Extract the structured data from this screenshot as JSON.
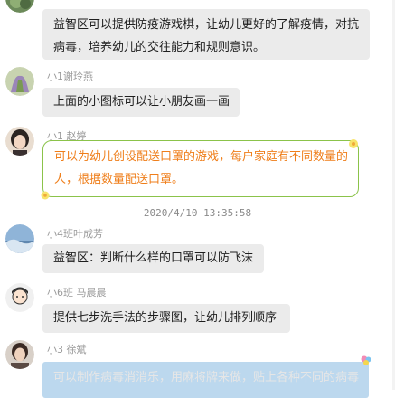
{
  "messages": [
    {
      "name": "",
      "lines": [
        "益智区可以提供防疫游戏棋，让幼儿更好的了解疫情，对抗",
        "病毒，培养幼儿的交往能力和规则意识。"
      ]
    },
    {
      "name": "小1谢玲燕",
      "lines": [
        "上面的小图标可以让小朋友画一画"
      ]
    },
    {
      "name": "小1 赵婷",
      "lines": [
        "可以为幼儿创设配送口罩的游戏，每户家庭有不同数量的",
        "人，根据数量配送口罩。"
      ]
    },
    {
      "name": "小4班叶成芳",
      "lines": [
        "益智区：判断什么样的口罩可以防飞沫"
      ]
    },
    {
      "name": "小6班 马晨晨",
      "lines": [
        "提供七步洗手法的步骤图，让幼儿排列顺序"
      ]
    },
    {
      "name": "小3  徐斌",
      "lines": [
        "可以制作病毒消消乐，用麻将牌来做，贴上各种不同的病毒"
      ]
    }
  ],
  "timestamp": "2020/4/10 13:35:58",
  "colors": {
    "bubble_gray": "#ebebeb",
    "bubble_green_border": "#8bc34a",
    "bubble_green_text": "#ef7e1a",
    "bubble_blue": "#bcd8ee"
  }
}
